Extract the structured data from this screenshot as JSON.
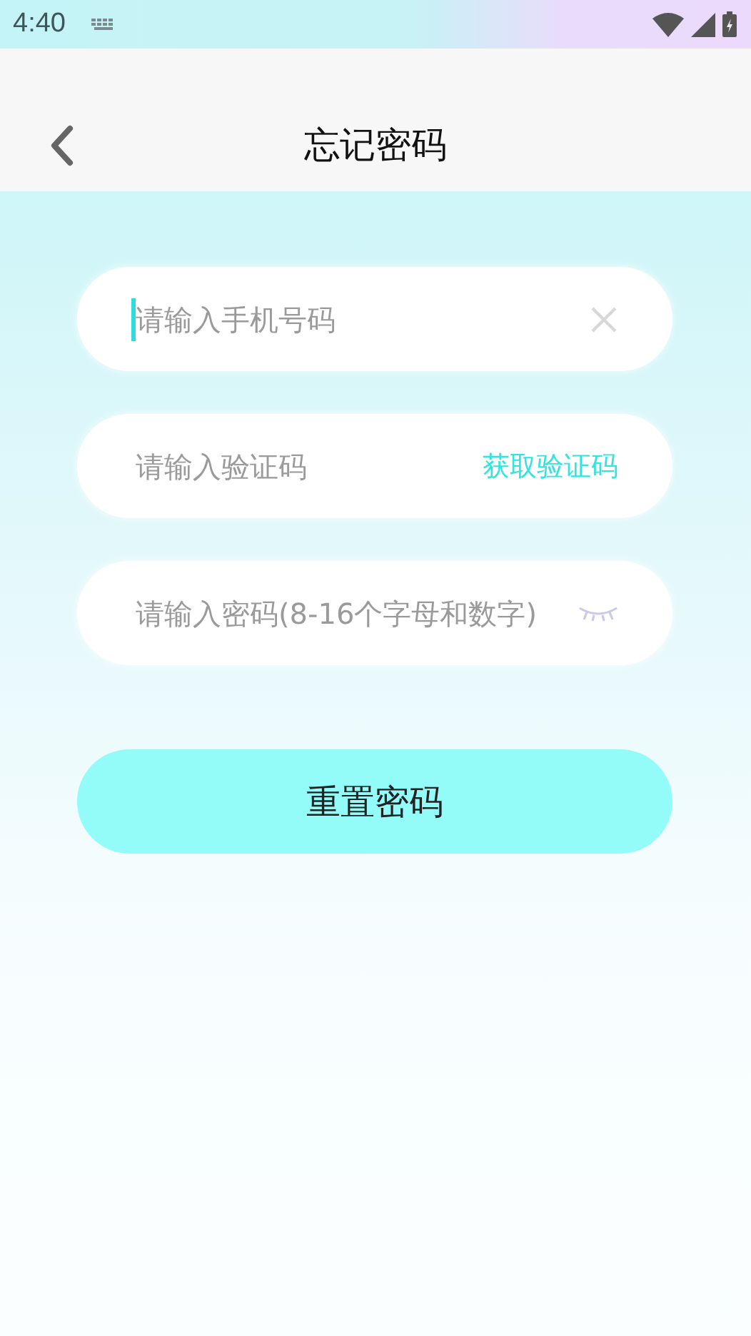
{
  "status_bar": {
    "time": "4:40"
  },
  "header": {
    "title": "忘记密码"
  },
  "fields": [
    {
      "kind": "clear",
      "placeholder": "请输入手机号码",
      "focused": true
    },
    {
      "kind": "code",
      "placeholder": "请输入验证码",
      "focused": false,
      "action": "获取验证码"
    },
    {
      "kind": "eye",
      "placeholder": "请输入密码(8-16个字母和数字)",
      "focused": false
    }
  ],
  "submit": {
    "label": "重置密码"
  }
}
